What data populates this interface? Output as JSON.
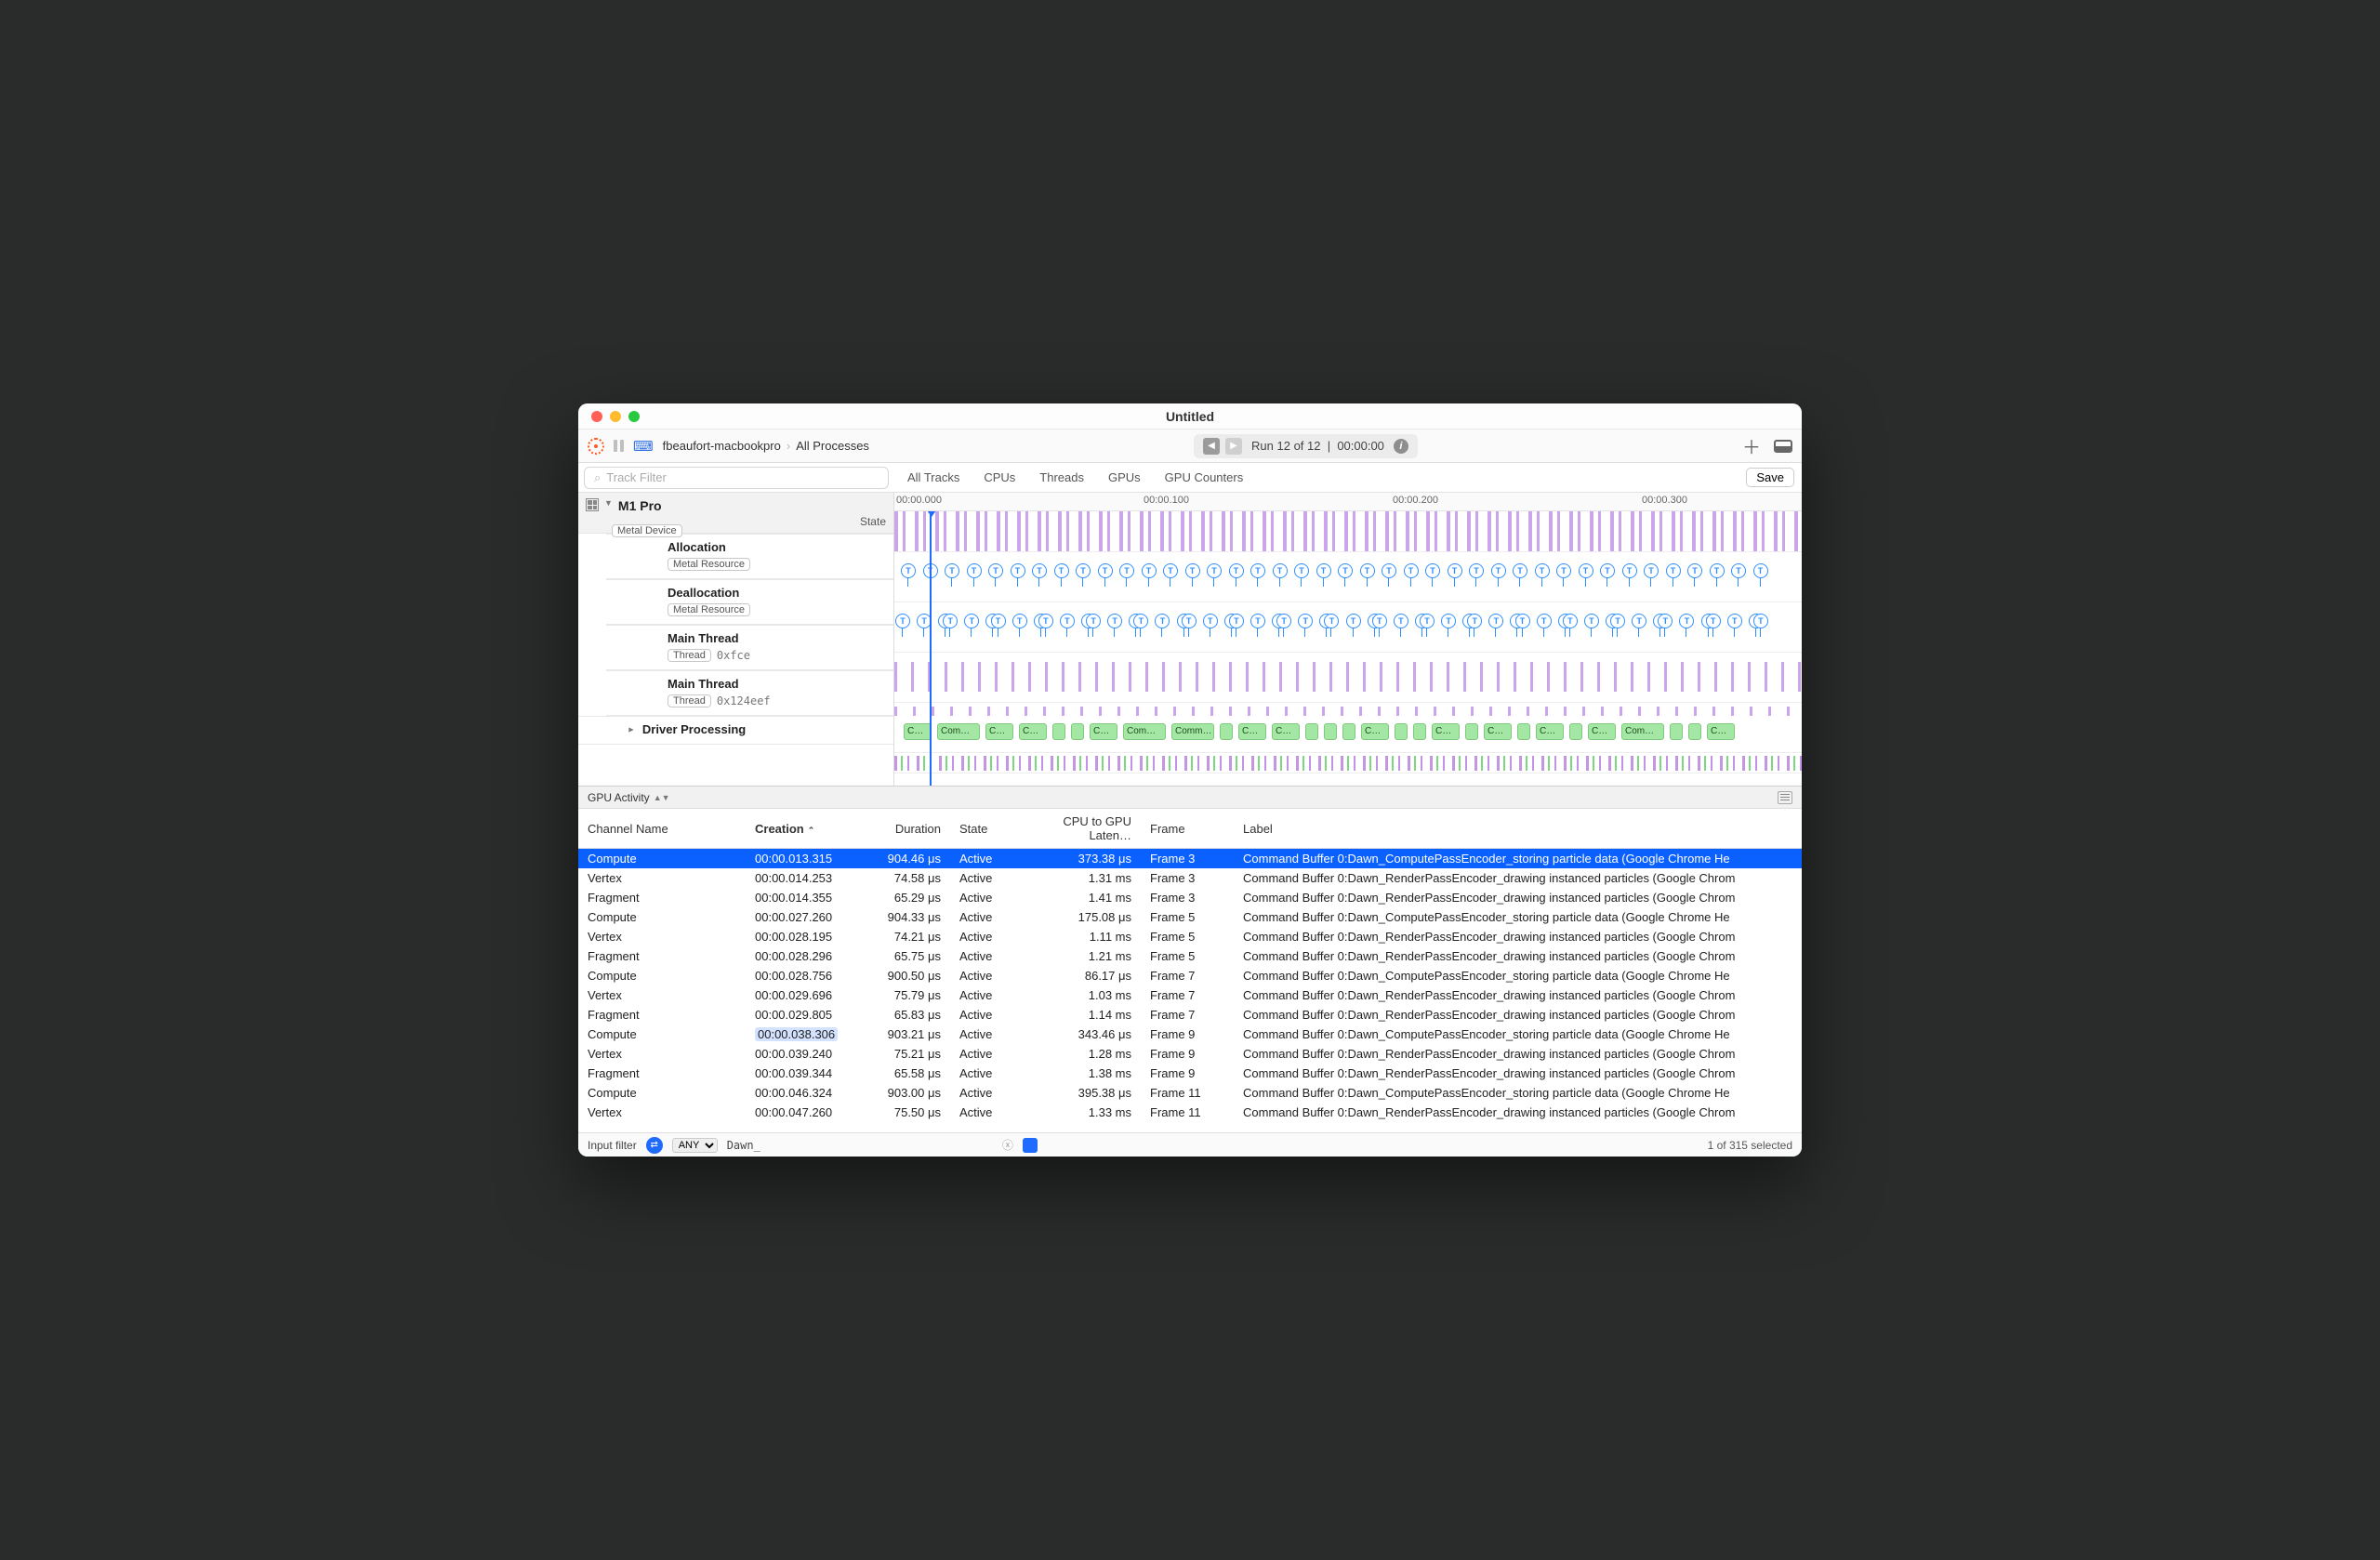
{
  "window": {
    "title": "Untitled"
  },
  "toolbar": {
    "breadcrumb_device": "fbeaufort-macbookpro",
    "breadcrumb_scope": "All Processes",
    "run_label": "Run 12 of 12",
    "run_time": "00:00:00"
  },
  "filter": {
    "placeholder": "Track Filter"
  },
  "view_tabs": {
    "all_tracks": "All Tracks",
    "cpus": "CPUs",
    "threads": "Threads",
    "gpus": "GPUs",
    "gpu_counters": "GPU Counters",
    "save": "Save"
  },
  "ruler": {
    "t0": "00:00.000",
    "t1": "00:00.100",
    "t2": "00:00.200",
    "t3": "00:00.300"
  },
  "sidebar": {
    "device": "M1 Pro",
    "device_chip": "Metal Device",
    "state_label": "State",
    "rows": [
      {
        "name": "Allocation",
        "chip": "Metal Resource"
      },
      {
        "name": "Deallocation",
        "chip": "Metal Resource"
      },
      {
        "name": "Main Thread",
        "chip": "Thread",
        "sub": "0xfce"
      },
      {
        "name": "Main Thread",
        "chip": "Thread",
        "sub": "0x124eef"
      }
    ],
    "driver": "Driver Processing"
  },
  "green_blocks": [
    "C…",
    "Com…",
    "C…",
    "C…",
    "",
    "",
    "C…",
    "Com…",
    "Comm…",
    "",
    "C…",
    "C…",
    "",
    "",
    "",
    "C…",
    "",
    "",
    "C…",
    "",
    "C…",
    "",
    "C…",
    "",
    "C…",
    "Com…",
    "",
    "",
    "C…"
  ],
  "section": {
    "label": "GPU Activity"
  },
  "table": {
    "columns": {
      "channel": "Channel Name",
      "creation": "Creation",
      "duration": "Duration",
      "state": "State",
      "latency": "CPU to GPU Laten…",
      "frame": "Frame",
      "label": "Label"
    },
    "rows": [
      {
        "channel": "Compute",
        "creation": "00:00.013.315",
        "duration": "904.46 μs",
        "state": "Active",
        "latency": "373.38 μs",
        "frame": "Frame 3",
        "label": "Command Buffer 0:Dawn_ComputePassEncoder_storing particle data   (Google Chrome He",
        "selected": true
      },
      {
        "channel": "Vertex",
        "creation": "00:00.014.253",
        "duration": "74.58 μs",
        "state": "Active",
        "latency": "1.31 ms",
        "frame": "Frame 3",
        "label": "Command Buffer 0:Dawn_RenderPassEncoder_drawing instanced particles   (Google Chrom"
      },
      {
        "channel": "Fragment",
        "creation": "00:00.014.355",
        "duration": "65.29 μs",
        "state": "Active",
        "latency": "1.41 ms",
        "frame": "Frame 3",
        "label": "Command Buffer 0:Dawn_RenderPassEncoder_drawing instanced particles   (Google Chrom"
      },
      {
        "channel": "Compute",
        "creation": "00:00.027.260",
        "duration": "904.33 μs",
        "state": "Active",
        "latency": "175.08 μs",
        "frame": "Frame 5",
        "label": "Command Buffer 0:Dawn_ComputePassEncoder_storing particle data   (Google Chrome He"
      },
      {
        "channel": "Vertex",
        "creation": "00:00.028.195",
        "duration": "74.21 μs",
        "state": "Active",
        "latency": "1.11 ms",
        "frame": "Frame 5",
        "label": "Command Buffer 0:Dawn_RenderPassEncoder_drawing instanced particles   (Google Chrom"
      },
      {
        "channel": "Fragment",
        "creation": "00:00.028.296",
        "duration": "65.75 μs",
        "state": "Active",
        "latency": "1.21 ms",
        "frame": "Frame 5",
        "label": "Command Buffer 0:Dawn_RenderPassEncoder_drawing instanced particles   (Google Chrom"
      },
      {
        "channel": "Compute",
        "creation": "00:00.028.756",
        "duration": "900.50 μs",
        "state": "Active",
        "latency": "86.17 μs",
        "frame": "Frame 7",
        "label": "Command Buffer 0:Dawn_ComputePassEncoder_storing particle data   (Google Chrome He"
      },
      {
        "channel": "Vertex",
        "creation": "00:00.029.696",
        "duration": "75.79 μs",
        "state": "Active",
        "latency": "1.03 ms",
        "frame": "Frame 7",
        "label": "Command Buffer 0:Dawn_RenderPassEncoder_drawing instanced particles   (Google Chrom"
      },
      {
        "channel": "Fragment",
        "creation": "00:00.029.805",
        "duration": "65.83 μs",
        "state": "Active",
        "latency": "1.14 ms",
        "frame": "Frame 7",
        "label": "Command Buffer 0:Dawn_RenderPassEncoder_drawing instanced particles   (Google Chrom"
      },
      {
        "channel": "Compute",
        "creation": "00:00.038.306",
        "duration": "903.21 μs",
        "state": "Active",
        "latency": "343.46 μs",
        "frame": "Frame 9",
        "label": "Command Buffer 0:Dawn_ComputePassEncoder_storing particle data   (Google Chrome He",
        "highlight_creation": true
      },
      {
        "channel": "Vertex",
        "creation": "00:00.039.240",
        "duration": "75.21 μs",
        "state": "Active",
        "latency": "1.28 ms",
        "frame": "Frame 9",
        "label": "Command Buffer 0:Dawn_RenderPassEncoder_drawing instanced particles   (Google Chrom"
      },
      {
        "channel": "Fragment",
        "creation": "00:00.039.344",
        "duration": "65.58 μs",
        "state": "Active",
        "latency": "1.38 ms",
        "frame": "Frame 9",
        "label": "Command Buffer 0:Dawn_RenderPassEncoder_drawing instanced particles   (Google Chrom"
      },
      {
        "channel": "Compute",
        "creation": "00:00.046.324",
        "duration": "903.00 μs",
        "state": "Active",
        "latency": "395.38 μs",
        "frame": "Frame 11",
        "label": "Command Buffer 0:Dawn_ComputePassEncoder_storing particle data   (Google Chrome He"
      },
      {
        "channel": "Vertex",
        "creation": "00:00.047.260",
        "duration": "75.50 μs",
        "state": "Active",
        "latency": "1.33 ms",
        "frame": "Frame 11",
        "label": "Command Buffer 0:Dawn_RenderPassEncoder_drawing instanced particles   (Google Chrom"
      }
    ]
  },
  "footer": {
    "input_label": "Input filter",
    "mode": "ANY",
    "filter_text": "Dawn_",
    "status": "1 of 315 selected"
  }
}
